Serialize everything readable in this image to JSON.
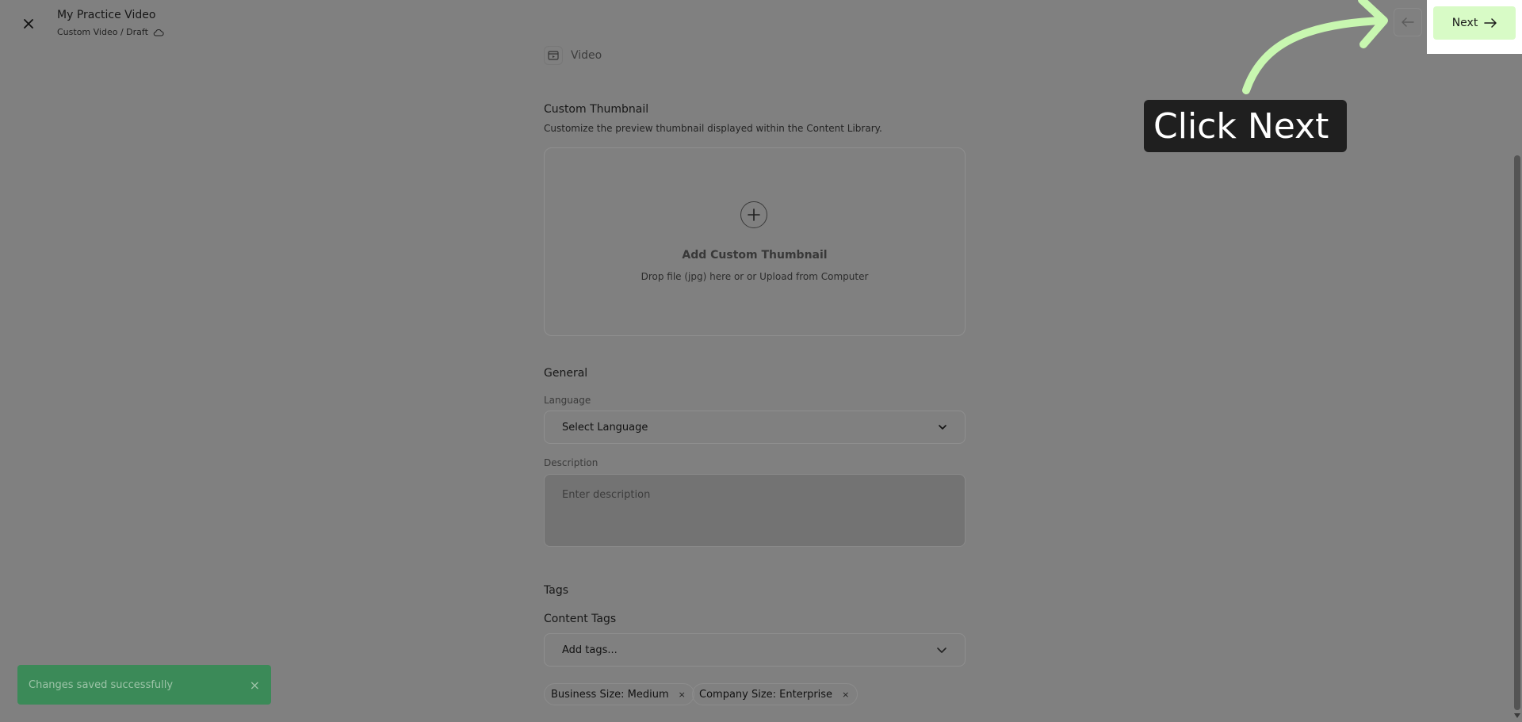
{
  "header": {
    "title": "My Practice Video",
    "breadcrumb": "Custom Video / Draft",
    "next_label": "Next"
  },
  "content": {
    "type_label": "Video",
    "thumbnail": {
      "title": "Custom Thumbnail",
      "subtitle": "Customize the preview thumbnail displayed within the Content Library.",
      "add_label": "Add Custom Thumbnail",
      "hint": "Drop file (jpg) here or or Upload from Computer"
    },
    "general": {
      "title": "General",
      "language_label": "Language",
      "language_value": "Select Language",
      "description_label": "Description",
      "description_placeholder": "Enter description"
    },
    "tags": {
      "title": "Tags",
      "content_tags_label": "Content Tags",
      "add_tags_placeholder": "Add tags...",
      "items": [
        "Business Size: Medium",
        "Company Size: Enterprise"
      ]
    }
  },
  "callout": {
    "text": "Click Next",
    "arrow_color": "#c8f7b0"
  },
  "toast": {
    "message": "Changes saved successfully",
    "close_glyph": "×"
  },
  "icons": {
    "close": "close-icon",
    "cloud": "cloud-icon",
    "back": "arrow-left-icon",
    "next": "arrow-right-icon",
    "video": "video-icon",
    "plus": "plus-icon",
    "chevron": "chevron-down-icon",
    "tag_remove": "×"
  },
  "colors": {
    "overlay": "#808080",
    "next_button": "#d8fbc6",
    "toast": "#3b8a58",
    "callout": "#1f1f1f"
  }
}
